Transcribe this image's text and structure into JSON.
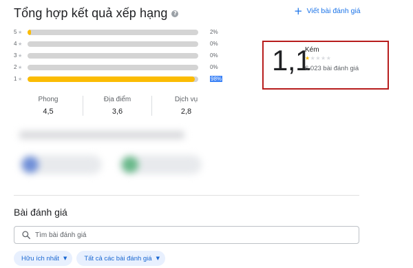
{
  "header": {
    "title": "Tổng hợp kết quả xếp hạng",
    "info_glyph": "?",
    "write_review_label": "Viết bài đánh giá",
    "plus_glyph": "+"
  },
  "histogram": [
    {
      "stars": "5",
      "fraction": 0.02,
      "percent_label": "2%"
    },
    {
      "stars": "4",
      "fraction": 0.0,
      "percent_label": "0%"
    },
    {
      "stars": "3",
      "fraction": 0.0,
      "percent_label": "0%"
    },
    {
      "stars": "2",
      "fraction": 0.0,
      "percent_label": "0%"
    },
    {
      "stars": "1",
      "fraction": 0.98,
      "percent_label": "98%"
    }
  ],
  "categories": [
    {
      "name": "Phong",
      "score": "4,5"
    },
    {
      "name": "Địa điểm",
      "score": "3,6"
    },
    {
      "name": "Dịch vụ",
      "score": "2,8"
    }
  ],
  "summary": {
    "score": "1,1",
    "label": "Kém",
    "stars_filled": 1,
    "stars_total": 5,
    "review_count": "6.023 bài đánh giá"
  },
  "reviews": {
    "title": "Bài đánh giá",
    "search_placeholder": "Tìm bài đánh giá",
    "filters": [
      {
        "label": "Hữu ích nhất"
      },
      {
        "label": "Tất cả các bài đánh giá"
      }
    ]
  },
  "colors": {
    "accent": "#1a73e8",
    "star": "#fbbc04",
    "bar_track": "#d4d4d4",
    "highlight_border": "#b71c1c"
  },
  "icons": {
    "info": "info-icon",
    "plus": "plus-icon",
    "search": "search-icon",
    "chevron": "chevron-down-icon",
    "star": "star-icon"
  }
}
